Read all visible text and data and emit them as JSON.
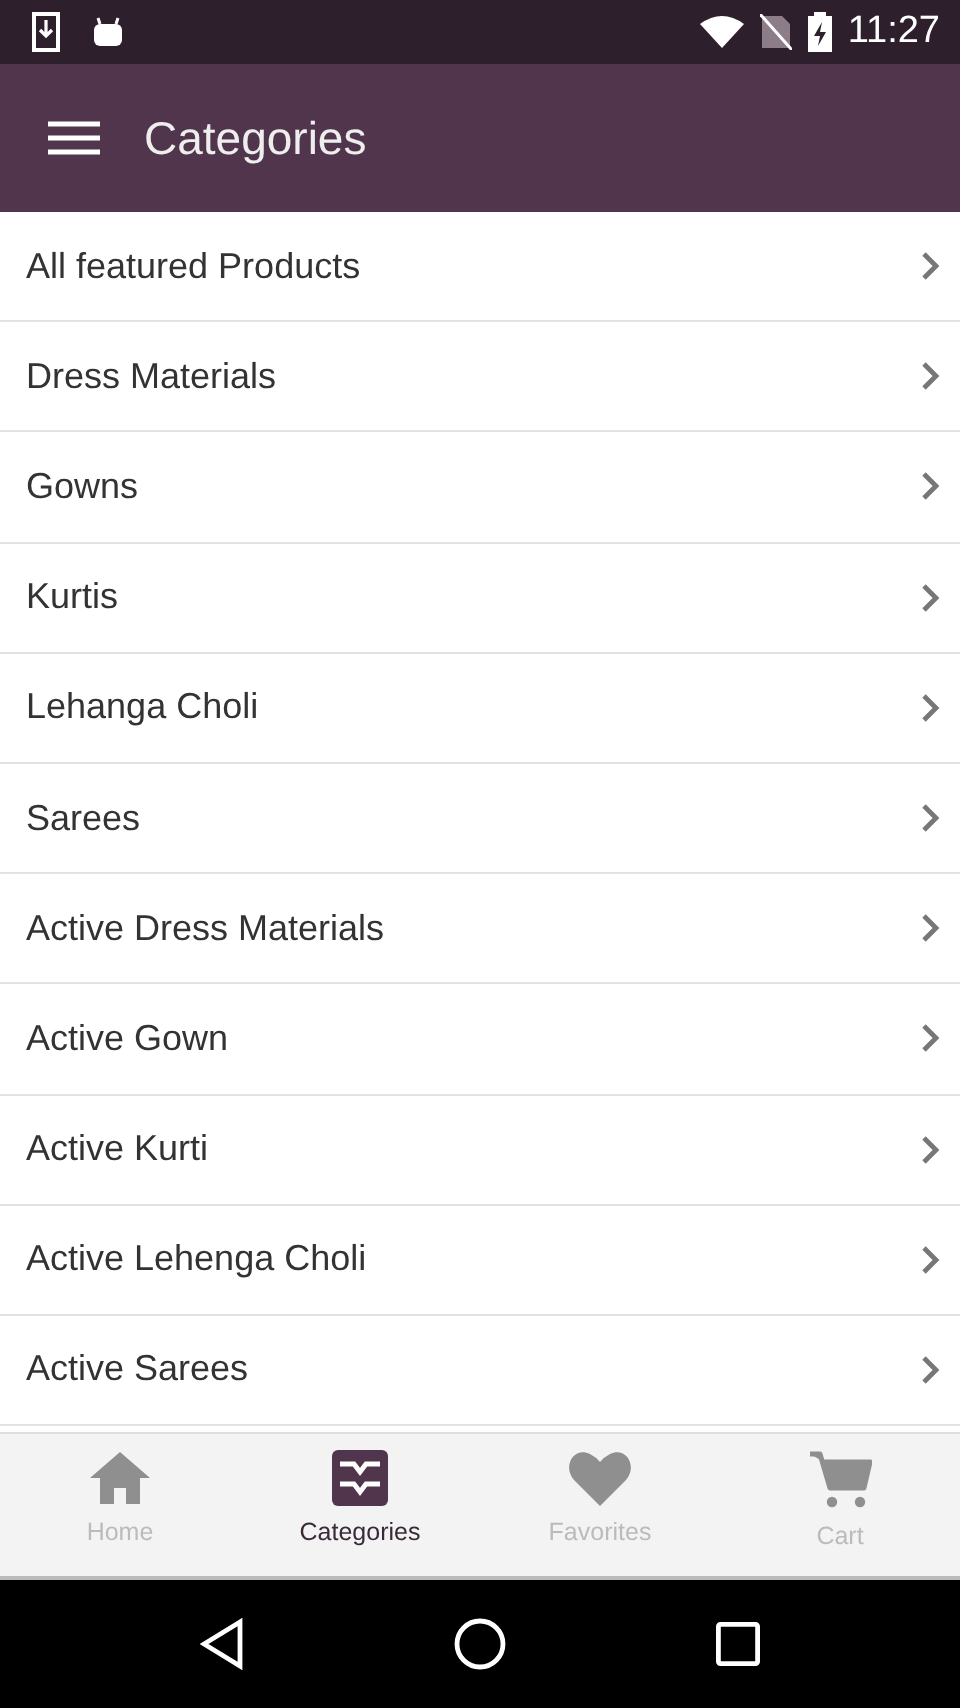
{
  "status_bar": {
    "time": "11:27"
  },
  "app_bar": {
    "title": "Categories"
  },
  "categories": [
    {
      "label": "All featured Products"
    },
    {
      "label": "Dress Materials"
    },
    {
      "label": "Gowns"
    },
    {
      "label": "Kurtis"
    },
    {
      "label": "Lehanga Choli"
    },
    {
      "label": "Sarees"
    },
    {
      "label": "Active Dress Materials"
    },
    {
      "label": "Active Gown"
    },
    {
      "label": "Active Kurti"
    },
    {
      "label": "Active Lehenga Choli"
    },
    {
      "label": "Active Sarees"
    }
  ],
  "bottom_nav": [
    {
      "kind": "home",
      "label": "Home",
      "selected": false
    },
    {
      "kind": "categories",
      "label": "Categories",
      "selected": true
    },
    {
      "kind": "favorites",
      "label": "Favorites",
      "selected": false
    },
    {
      "kind": "cart",
      "label": "Cart",
      "selected": false
    }
  ]
}
